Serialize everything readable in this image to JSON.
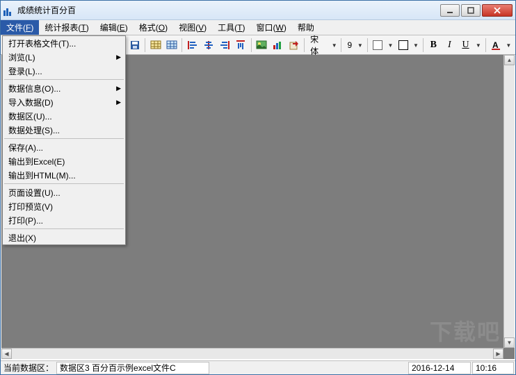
{
  "window": {
    "title": "成绩统计百分百"
  },
  "menubar": [
    {
      "label": "文件",
      "key": "F",
      "active": true
    },
    {
      "label": "统计报表",
      "key": "T"
    },
    {
      "label": "编辑",
      "key": "E"
    },
    {
      "label": "格式",
      "key": "O"
    },
    {
      "label": "视图",
      "key": "V"
    },
    {
      "label": "工具",
      "key": "T"
    },
    {
      "label": "窗口",
      "key": "W"
    },
    {
      "label": "帮助"
    }
  ],
  "file_menu": [
    {
      "label": "打开表格文件(T)...",
      "sep": false
    },
    {
      "label": "浏览(L)",
      "arrow": true
    },
    {
      "label": "登录(L)..."
    },
    {
      "sep": true
    },
    {
      "label": "数据信息(O)...",
      "arrow": true
    },
    {
      "label": "导入数据(D)",
      "arrow": true
    },
    {
      "label": "数据区(U)..."
    },
    {
      "label": "数据处理(S)..."
    },
    {
      "sep": true
    },
    {
      "label": "保存(A)..."
    },
    {
      "label": "输出到Excel(E)"
    },
    {
      "label": "输出到HTML(M)..."
    },
    {
      "sep": true
    },
    {
      "label": "页面设置(U)..."
    },
    {
      "label": "打印预览(V)"
    },
    {
      "label": "打印(P)..."
    },
    {
      "sep": true
    },
    {
      "label": "退出(X)"
    }
  ],
  "toolbar": {
    "font_name": "宋体",
    "font_size": "9",
    "bold": "B",
    "italic": "I",
    "underline": "U"
  },
  "status": {
    "region_label": "当前数据区：",
    "region_value": "数据区3 百分百示例excel文件C",
    "date": "2016-12-14",
    "time": "10:16"
  },
  "watermark": "下载吧"
}
